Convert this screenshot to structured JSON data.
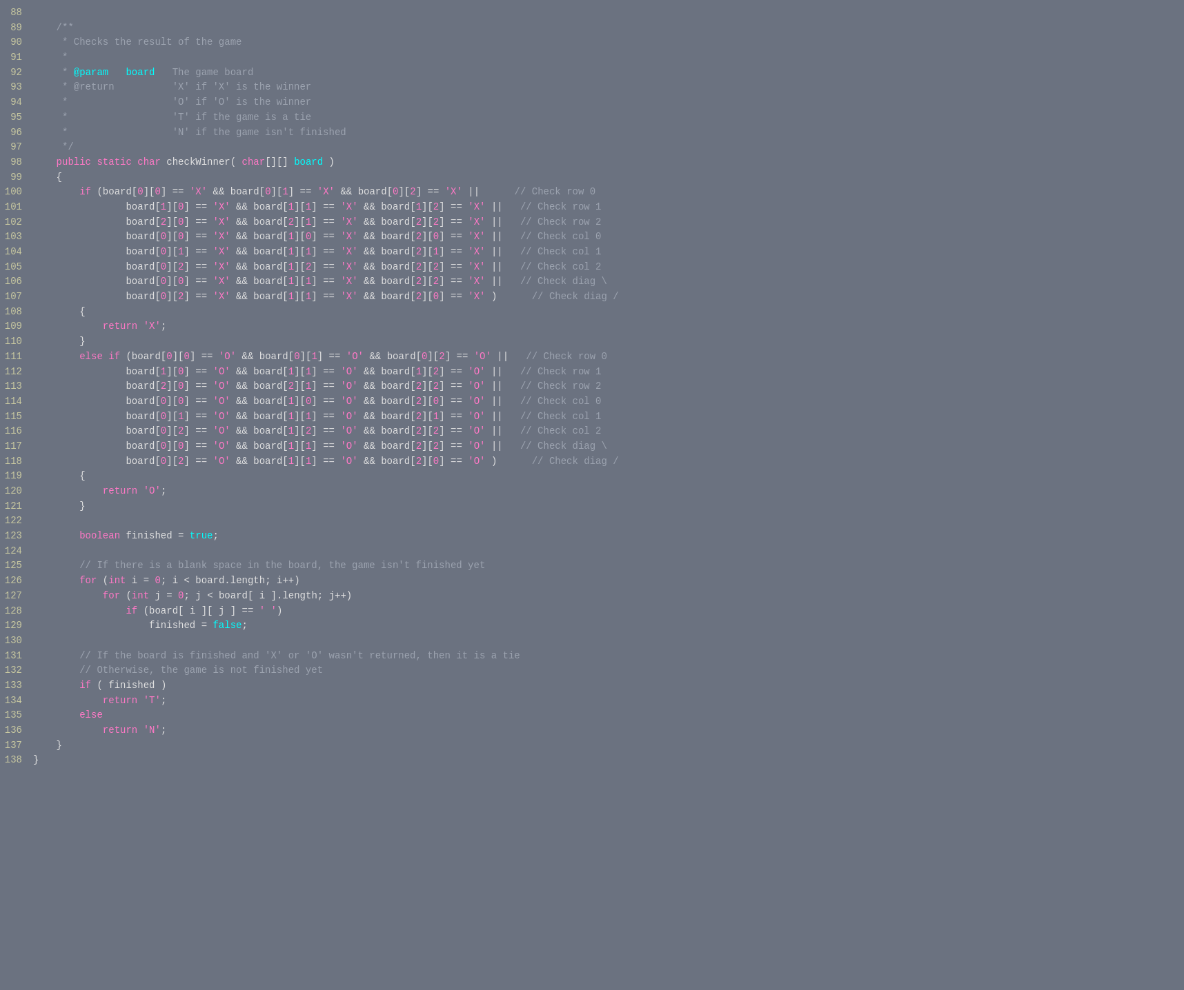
{
  "editor": {
    "background": "#6b7280",
    "lines": []
  }
}
